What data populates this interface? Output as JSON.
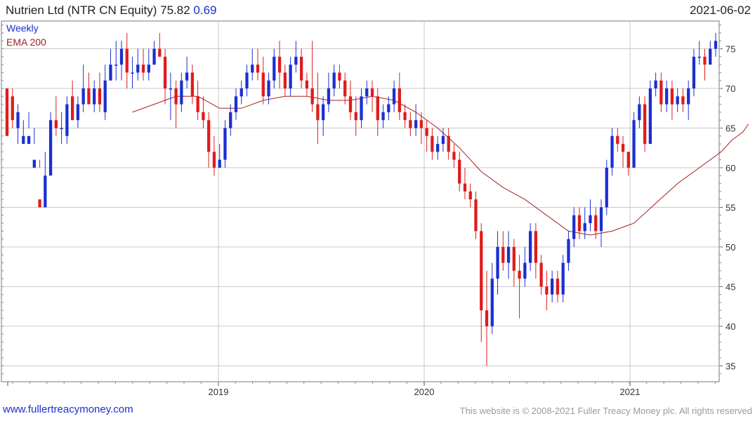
{
  "header": {
    "instrument": "Nutrien Ltd (NTR CN Equity)",
    "last_price": "75.82",
    "change": "0.69",
    "date": "2021-06-02"
  },
  "footer": {
    "link_text": "www.fullertreacymoney.com",
    "copyright": "This website is © 2008-2021 Fuller Treacy Money plc. All rights reserved"
  },
  "colors": {
    "up": "#1a2fd1",
    "down": "#e01b1b",
    "ema": "#a81e1e",
    "grid": "#c8c8c8"
  },
  "chart_data": {
    "type": "candlestick",
    "frequency_label": "Weekly",
    "legend": [
      "Weekly",
      "EMA 200"
    ],
    "x_axis_ticks": [
      "2019",
      "2020",
      "2021"
    ],
    "y_axis_ticks": [
      35,
      40,
      45,
      50,
      55,
      60,
      65,
      70,
      75
    ],
    "ylim": [
      33,
      78.5
    ],
    "y_axis_side": "right",
    "grid": true,
    "candles": [
      [
        70,
        64,
        72,
        72
      ],
      [
        69,
        66,
        70,
        65
      ],
      [
        65,
        67,
        68,
        63
      ],
      [
        63,
        64,
        66,
        64
      ],
      [
        63,
        64,
        67,
        65
      ],
      [
        60,
        61,
        65,
        63
      ],
      [
        56,
        55,
        61,
        60
      ],
      [
        55,
        59,
        62,
        58
      ],
      [
        59,
        66,
        67,
        65
      ],
      [
        66,
        65,
        69,
        64
      ],
      [
        65,
        65,
        67,
        63
      ],
      [
        64,
        68,
        69,
        63
      ],
      [
        69,
        66,
        71,
        66
      ],
      [
        66,
        68,
        69,
        65
      ],
      [
        68,
        70,
        73,
        67
      ],
      [
        70,
        68,
        72,
        68
      ],
      [
        68,
        70,
        71,
        67
      ],
      [
        70,
        68,
        72,
        67
      ],
      [
        67,
        71,
        73,
        66
      ],
      [
        71,
        73,
        75,
        71
      ],
      [
        73,
        73,
        76,
        71
      ],
      [
        73,
        75,
        76,
        71
      ],
      [
        75,
        72,
        77,
        70
      ],
      [
        72,
        72,
        74,
        70
      ],
      [
        72,
        73,
        75,
        71
      ],
      [
        73,
        72,
        75,
        71
      ],
      [
        72,
        73,
        75,
        71
      ],
      [
        73,
        75,
        76,
        73
      ],
      [
        75,
        74,
        77,
        74
      ],
      [
        74,
        70,
        75,
        68
      ],
      [
        70,
        70,
        72,
        66
      ],
      [
        70,
        68,
        71,
        65
      ],
      [
        68,
        71,
        72,
        67
      ],
      [
        71,
        72,
        74,
        70
      ],
      [
        72,
        69,
        73,
        68
      ],
      [
        69,
        67,
        71,
        66
      ],
      [
        67,
        66,
        69,
        65
      ],
      [
        66,
        62,
        67,
        60
      ],
      [
        62,
        60,
        64,
        59
      ],
      [
        60,
        61,
        63,
        60
      ],
      [
        61,
        65,
        66,
        60
      ],
      [
        65,
        67,
        68,
        64
      ],
      [
        67,
        69,
        70,
        66
      ],
      [
        69,
        70,
        71,
        68
      ],
      [
        70,
        72,
        73,
        69
      ],
      [
        72,
        73,
        75,
        71
      ],
      [
        73,
        72,
        75,
        71
      ],
      [
        72,
        69,
        74,
        68
      ],
      [
        69,
        71,
        72,
        68
      ],
      [
        71,
        74,
        75,
        70
      ],
      [
        74,
        72,
        76,
        70
      ],
      [
        72,
        70,
        73,
        69
      ],
      [
        70,
        73,
        74,
        69
      ],
      [
        73,
        74,
        76,
        72
      ],
      [
        74,
        71,
        75,
        70
      ],
      [
        71,
        70,
        72,
        69
      ],
      [
        70,
        68,
        76,
        67
      ],
      [
        68,
        66,
        72,
        63
      ],
      [
        66,
        68,
        69,
        64
      ],
      [
        68,
        70,
        72,
        67
      ],
      [
        70,
        72,
        73,
        69
      ],
      [
        72,
        71,
        73,
        70
      ],
      [
        71,
        69,
        72,
        68
      ],
      [
        69,
        67,
        71,
        66
      ],
      [
        67,
        66,
        69,
        64
      ],
      [
        66,
        69,
        70,
        65
      ],
      [
        69,
        70,
        71,
        68
      ],
      [
        70,
        69,
        71,
        67
      ],
      [
        69,
        66,
        70,
        64
      ],
      [
        66,
        67,
        68,
        65
      ],
      [
        67,
        68,
        69,
        66
      ],
      [
        68,
        70,
        71,
        67
      ],
      [
        70,
        67,
        72,
        66
      ],
      [
        67,
        66,
        68,
        65
      ],
      [
        66,
        65,
        67,
        64
      ],
      [
        65,
        66,
        68,
        64
      ],
      [
        66,
        65,
        67,
        63
      ],
      [
        65,
        64,
        66,
        62
      ],
      [
        64,
        62,
        65,
        61
      ],
      [
        62,
        63,
        64,
        61
      ],
      [
        63,
        64,
        65,
        62
      ],
      [
        64,
        62,
        65,
        61
      ],
      [
        62,
        61,
        63,
        60
      ],
      [
        61,
        58,
        62,
        57
      ],
      [
        58,
        57,
        60,
        56
      ],
      [
        57,
        56,
        58,
        55
      ],
      [
        56,
        52,
        57,
        51
      ],
      [
        52,
        42,
        53,
        38
      ],
      [
        42,
        40,
        47,
        35
      ],
      [
        40,
        46,
        48,
        39
      ],
      [
        46,
        50,
        52,
        44
      ],
      [
        50,
        48,
        52,
        47
      ],
      [
        48,
        50,
        52,
        46
      ],
      [
        50,
        47,
        51,
        45
      ],
      [
        47,
        46,
        49,
        41
      ],
      [
        46,
        48,
        50,
        45
      ],
      [
        48,
        52,
        53,
        47
      ],
      [
        52,
        48,
        53,
        46
      ],
      [
        48,
        45,
        49,
        44
      ],
      [
        45,
        44,
        47,
        42
      ],
      [
        44,
        46,
        47,
        43
      ],
      [
        46,
        44,
        47,
        43
      ],
      [
        44,
        48,
        49,
        43
      ],
      [
        48,
        51,
        52,
        47
      ],
      [
        51,
        54,
        55,
        50
      ],
      [
        54,
        52,
        55,
        51
      ],
      [
        52,
        53,
        55,
        51
      ],
      [
        53,
        54,
        56,
        52
      ],
      [
        54,
        52,
        55,
        51
      ],
      [
        52,
        55,
        56,
        50
      ],
      [
        55,
        60,
        61,
        54
      ],
      [
        60,
        64,
        65,
        59
      ],
      [
        64,
        63,
        65,
        62
      ],
      [
        63,
        62,
        64,
        60
      ],
      [
        62,
        60,
        62,
        59
      ],
      [
        60,
        66,
        67,
        60
      ],
      [
        66,
        68,
        69,
        65
      ],
      [
        68,
        63,
        69,
        62
      ],
      [
        63,
        70,
        71,
        63
      ],
      [
        70,
        71,
        72,
        69
      ],
      [
        71,
        68,
        72,
        67
      ],
      [
        68,
        70,
        71,
        67
      ],
      [
        70,
        68,
        71,
        66
      ],
      [
        68,
        69,
        70,
        67
      ],
      [
        69,
        68,
        70,
        67
      ],
      [
        68,
        70,
        71,
        66
      ],
      [
        70,
        74,
        75,
        69
      ],
      [
        74,
        74,
        76,
        73
      ],
      [
        74,
        73,
        75,
        71
      ],
      [
        73,
        75,
        76,
        73
      ],
      [
        75,
        76,
        77,
        74
      ]
    ],
    "ema": [
      [
        23,
        67.0
      ],
      [
        27,
        68.0
      ],
      [
        31,
        69.0
      ],
      [
        35,
        69.0
      ],
      [
        39,
        67.5
      ],
      [
        43,
        67.5
      ],
      [
        47,
        68.5
      ],
      [
        51,
        69.0
      ],
      [
        55,
        69.0
      ],
      [
        59,
        68.5
      ],
      [
        63,
        68.5
      ],
      [
        67,
        69.0
      ],
      [
        71,
        68.5
      ],
      [
        75,
        67.0
      ],
      [
        79,
        65.0
      ],
      [
        83,
        62.5
      ],
      [
        87,
        59.5
      ],
      [
        91,
        57.5
      ],
      [
        95,
        56.0
      ],
      [
        99,
        54.0
      ],
      [
        103,
        52.0
      ],
      [
        107,
        51.5
      ],
      [
        111,
        52.0
      ],
      [
        115,
        53.0
      ],
      [
        119,
        55.5
      ],
      [
        123,
        58.0
      ],
      [
        127,
        60.0
      ],
      [
        131,
        62.0
      ],
      [
        133,
        63.5
      ],
      [
        135,
        64.5
      ],
      [
        136,
        65.5
      ]
    ]
  }
}
